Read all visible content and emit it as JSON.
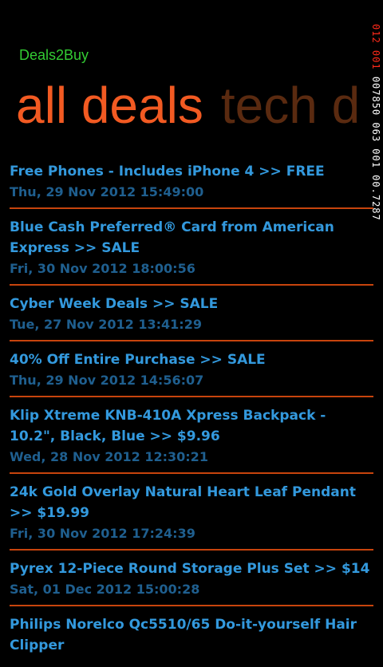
{
  "app": {
    "title": "Deals2Buy"
  },
  "pivot": {
    "active": "all deals",
    "next": "tech d"
  },
  "side_counter": {
    "line1": "012 001",
    "line2": "007850 063 001 00.7287"
  },
  "deals": [
    {
      "title": "Free Phones - Includes iPhone 4 >> FREE",
      "date": "Thu, 29 Nov 2012 15:49:00"
    },
    {
      "title": "Blue Cash Preferred® Card from American Express >> SALE",
      "date": "Fri, 30 Nov 2012 18:00:56"
    },
    {
      "title": "Cyber Week Deals >> SALE",
      "date": "Tue, 27 Nov 2012 13:41:29"
    },
    {
      "title": "40% Off Entire Purchase >> SALE",
      "date": "Thu, 29 Nov 2012 14:56:07"
    },
    {
      "title": "Klip Xtreme KNB-410A Xpress Backpack - 10.2\", Black, Blue >> $9.96",
      "date": "Wed, 28 Nov 2012 12:30:21"
    },
    {
      "title": "24k Gold Overlay Natural Heart Leaf Pendant >> $19.99",
      "date": "Fri, 30 Nov 2012 17:24:39"
    },
    {
      "title": "Pyrex 12-Piece Round Storage Plus Set >> $14",
      "date": "Sat, 01 Dec 2012 15:00:28"
    },
    {
      "title": "Philips Norelco Qc5510/65 Do-it-yourself Hair Clipper",
      "date": ""
    }
  ],
  "colors": {
    "accent": "#f25a22",
    "title_blue": "#3399dd",
    "date_blue": "#1f5f8f",
    "separator": "#c7440d",
    "app_title_green": "#33cc33"
  }
}
